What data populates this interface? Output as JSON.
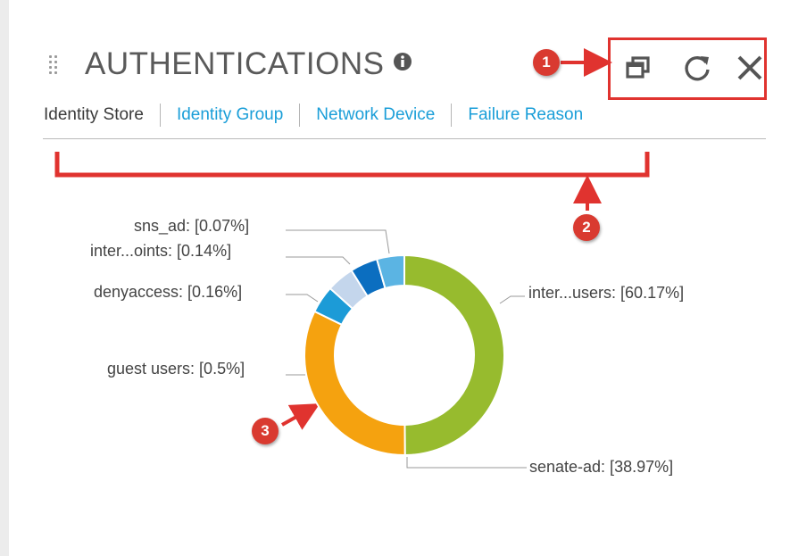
{
  "widget": {
    "title": "AUTHENTICATIONS",
    "icons": {
      "drag": "drag-handle-icon",
      "info": "info-icon",
      "detach": "detach-window-icon",
      "refresh": "refresh-icon",
      "close": "close-icon"
    }
  },
  "tabs": [
    {
      "label": "Identity Store",
      "active": true
    },
    {
      "label": "Identity Group",
      "active": false
    },
    {
      "label": "Network Device",
      "active": false
    },
    {
      "label": "Failure Reason",
      "active": false
    }
  ],
  "annotations": {
    "badge1": "1",
    "badge2": "2",
    "badge3": "3",
    "color": "#e0332f"
  },
  "chart_data": {
    "type": "pie",
    "variant": "donut",
    "slices": [
      {
        "label": "inter...users: [60.17%]",
        "value": 60.17,
        "color": "#97bb2e"
      },
      {
        "label": "senate-ad: [38.97%]",
        "value": 38.97,
        "color": "#f5a20f"
      },
      {
        "label": "guest users: [0.5%]",
        "value": 0.5,
        "color": "#1c9bd7"
      },
      {
        "label": "denyaccess: [0.16%]",
        "value": 0.16,
        "color": "#c4d6ec"
      },
      {
        "label": "inter...oints: [0.14%]",
        "value": 0.14,
        "color": "#0b6ec0"
      },
      {
        "label": "sns_ad: [0.07%]",
        "value": 0.07,
        "color": "#5bb4e3"
      }
    ]
  }
}
